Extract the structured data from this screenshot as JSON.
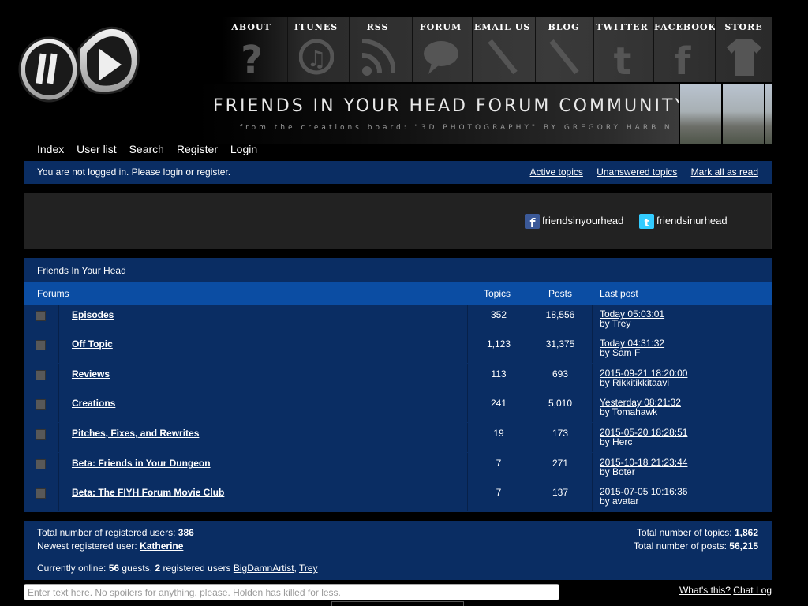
{
  "header": {
    "banner_title": "FRIENDS IN YOUR HEAD FORUM COMMUNITY",
    "banner_subtitle": "from the creations board: \"3D PHOTOGRAPHY\" BY GREGORY HARBIN",
    "top_nav": [
      {
        "label": "ABOUT",
        "icon": "question-icon"
      },
      {
        "label": "ITUNES",
        "icon": "music-note-icon"
      },
      {
        "label": "RSS",
        "icon": "rss-icon"
      },
      {
        "label": "FORUM",
        "icon": "speech-bubble-icon"
      },
      {
        "label": "EMAIL US",
        "icon": "pencil-icon"
      },
      {
        "label": "BLOG",
        "icon": "pencil-icon"
      },
      {
        "label": "TWITTER",
        "icon": "twitter-t-icon"
      },
      {
        "label": "FACEBOOK",
        "icon": "facebook-f-icon"
      },
      {
        "label": "STORE",
        "icon": "tshirt-icon"
      }
    ]
  },
  "main_nav": [
    "Index",
    "User list",
    "Search",
    "Register",
    "Login"
  ],
  "status": {
    "message": "You are not logged in. Please login or register.",
    "links": [
      "Active topics",
      "Unanswered topics",
      "Mark all as read"
    ]
  },
  "social": {
    "facebook": "friendsinyourhead",
    "twitter": "friendsinurhead"
  },
  "forum": {
    "caption": "Friends In Your Head",
    "headers": {
      "forums": "Forums",
      "topics": "Topics",
      "posts": "Posts",
      "last_post": "Last post"
    },
    "rows": [
      {
        "name": "Episodes",
        "topics": "352",
        "posts": "18,556",
        "last_time": "Today 05:03:01",
        "last_by": "by Trey"
      },
      {
        "name": "Off Topic",
        "topics": "1,123",
        "posts": "31,375",
        "last_time": "Today 04:31:32",
        "last_by": "by Sam F"
      },
      {
        "name": "Reviews",
        "topics": "113",
        "posts": "693",
        "last_time": "2015-09-21 18:20:00",
        "last_by": "by Rikkitikkitaavi"
      },
      {
        "name": "Creations",
        "topics": "241",
        "posts": "5,010",
        "last_time": "Yesterday 08:21:32",
        "last_by": "by Tomahawk"
      },
      {
        "name": "Pitches, Fixes, and Rewrites",
        "topics": "19",
        "posts": "173",
        "last_time": "2015-05-20 18:28:51",
        "last_by": "by Herc"
      },
      {
        "name": "Beta: Friends in Your Dungeon",
        "topics": "7",
        "posts": "271",
        "last_time": "2015-10-18 21:23:44",
        "last_by": "by Boter"
      },
      {
        "name": "Beta: The FIYH Forum Movie Club",
        "topics": "7",
        "posts": "137",
        "last_time": "2015-07-05 10:16:36",
        "last_by": "by avatar"
      }
    ]
  },
  "stats": {
    "registered_label": "Total number of registered users: ",
    "registered_value": "386",
    "newest_label": "Newest registered user: ",
    "newest_value": "Katherine",
    "topics_label": "Total number of topics: ",
    "topics_value": "1,862",
    "posts_label": "Total number of posts: ",
    "posts_value": "56,215",
    "online_prefix": "Currently online: ",
    "guests": "56",
    "guests_label": " guests, ",
    "registered_online": "2",
    "registered_online_label": " registered users ",
    "online_users": [
      "BigDamnArtist",
      "Trey"
    ]
  },
  "chat": {
    "placeholder": "Enter text here. No spoilers for anything, please. Holden has killed for less.",
    "whats_this": "What's this?",
    "chat_log": "Chat Log"
  },
  "colors": {
    "panel": "#0a2d63",
    "header_row": "#0b4da3",
    "background": "#000000"
  }
}
